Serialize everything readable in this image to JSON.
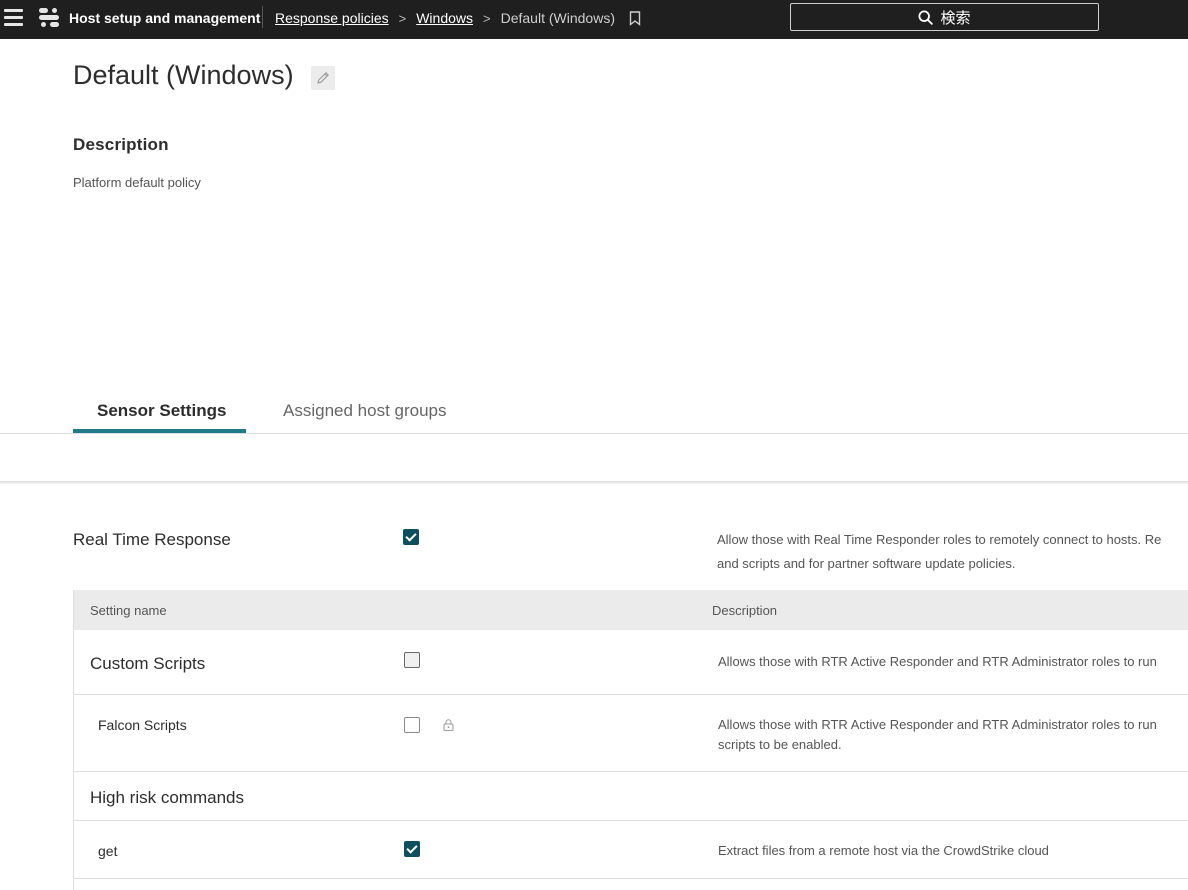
{
  "header": {
    "app_title": "Host setup and management",
    "breadcrumb": {
      "item1": "Response policies",
      "item2": "Windows",
      "current": "Default (Windows)",
      "sep": ">"
    },
    "search_label": "検索"
  },
  "page": {
    "title": "Default (Windows)",
    "description_heading": "Description",
    "description": "Platform default policy"
  },
  "tabs": {
    "sensor_settings": "Sensor Settings",
    "assigned_host_groups": "Assigned host groups"
  },
  "rtr": {
    "title": "Real Time Response",
    "checked": true,
    "desc_line1": "Allow those with Real Time Responder roles to remotely connect to hosts. Re",
    "desc_line2": "and scripts and for partner software update policies."
  },
  "table": {
    "col_setting": "Setting name",
    "col_description": "Description",
    "rows": [
      {
        "label": "Custom Scripts",
        "checked": false,
        "desc_line1": "Allows those with RTR Active Responder and RTR Administrator roles to run"
      },
      {
        "label": "Falcon Scripts",
        "checked": false,
        "locked": true,
        "desc_line1": "Allows those with RTR Active Responder and RTR Administrator roles to run",
        "desc_line2": "scripts to be enabled."
      },
      {
        "label": "High risk commands"
      },
      {
        "label": "get",
        "checked": true,
        "desc_line1": "Extract files from a remote host via the CrowdStrike cloud"
      }
    ]
  },
  "colors": {
    "topbar": "#1f1f1f",
    "accent": "#1f7b8c",
    "checkbox": "#0d4f5f"
  }
}
